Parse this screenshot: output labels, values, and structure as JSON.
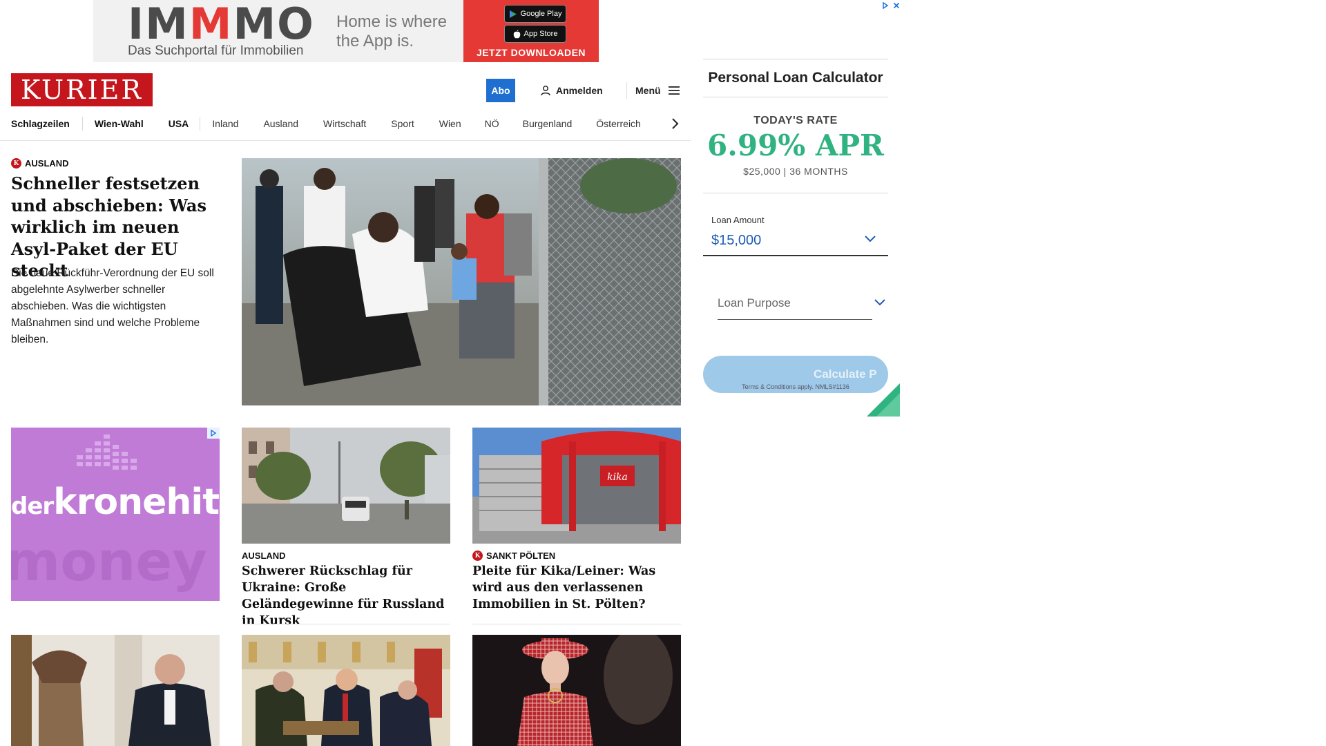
{
  "top_ad": {
    "logo_part1": "IM",
    "logo_part2": "M",
    "logo_part3": "MO",
    "subtitle": "Das Suchportal für Immobilien",
    "slogan": "Home is where the App is.",
    "google_play": "Google Play",
    "app_store": "App Store",
    "cta": "JETZT DOWNLOADEN"
  },
  "header": {
    "logo": "KURIER",
    "abo": "Abo",
    "login": "Anmelden",
    "menu": "Menü"
  },
  "nav": {
    "items": [
      "Schlagzeilen",
      "Wien-Wahl",
      "USA",
      "Inland",
      "Ausland",
      "Wirtschaft",
      "Sport",
      "Wien",
      "NÖ",
      "Burgenland",
      "Österreich"
    ]
  },
  "lead": {
    "kategorie": "Ausland",
    "title": "Schneller festsetzen und abschieben: Was wirklich im neuen Asyl-Paket der EU steckt",
    "teaser": "Die neue Rückführ-Verordnung der EU soll abgelehnte Asylwerber schneller abschieben. Was die wichtigsten Maßnahmen sind und welche Probleme bleiben."
  },
  "grid_ad": {
    "brand_small": "der",
    "brand": "kronehit",
    "ghost": "money m"
  },
  "cards": [
    {
      "kategorie": "Ausland",
      "title": "Schwerer Rückschlag für Ukraine: Große Geländegewinne für Russland in Kursk"
    },
    {
      "kategorie": "Sankt Pölten",
      "title": "Pleite für Kika/Leiner: Was wird aus den verlassenen Immobilien in St. Pölten?",
      "sign": "kika"
    }
  ],
  "loan_ad": {
    "title": "Personal Loan Calculator",
    "rate_label": "TODAY'S RATE",
    "rate": "6.99% APR",
    "terms": "$25,000 | 36 MONTHS",
    "amount_label": "Loan Amount",
    "amount": "$15,000",
    "purpose": "Loan Purpose",
    "calc_button": "Calculate P",
    "footnote": "Terms & Conditions apply. NMLS#1136"
  },
  "colors": {
    "kurier_red": "#c4161c",
    "abo_blue": "#1f6fd1",
    "rate_green": "#2fb380",
    "kronehit_purple": "#c07bd6"
  }
}
